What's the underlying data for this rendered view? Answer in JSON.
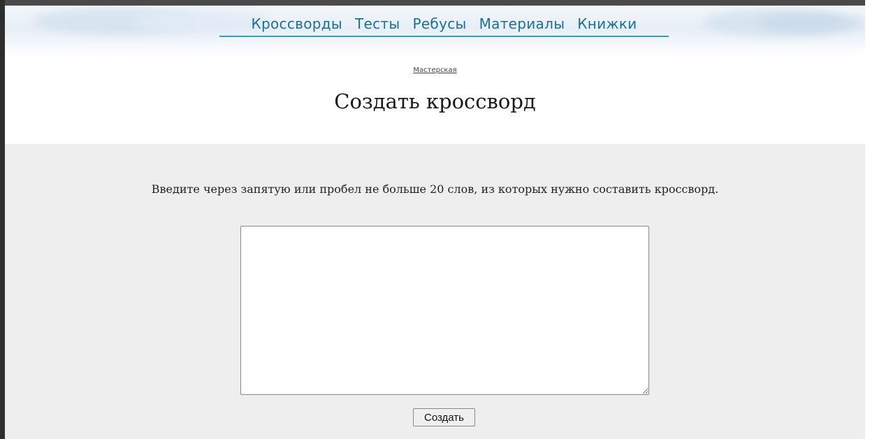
{
  "nav": {
    "items": [
      {
        "label": "Кроссворды"
      },
      {
        "label": "Тесты"
      },
      {
        "label": "Ребусы"
      },
      {
        "label": "Материалы"
      },
      {
        "label": "Книжки"
      }
    ]
  },
  "breadcrumb": {
    "label": "Мастерская"
  },
  "page": {
    "title": "Создать кроссворд"
  },
  "form": {
    "instruction": "Введите через запятую или пробел не больше 20 слов, из которых нужно составить кроссворд.",
    "textarea_value": "",
    "submit_label": "Создать"
  },
  "colors": {
    "nav_link": "#1d6f9b",
    "nav_underline": "#2aa6c4",
    "content_bg": "#eeeeee"
  }
}
